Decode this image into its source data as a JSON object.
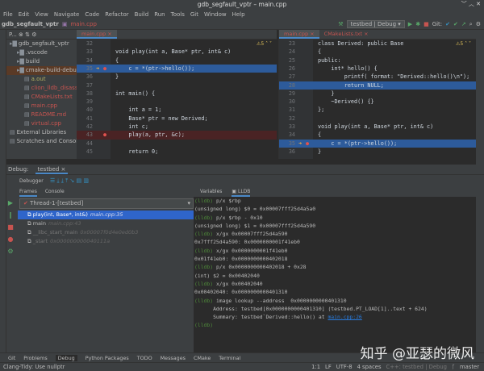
{
  "window": {
    "title": "gdb_segfault_vptr – main.cpp"
  },
  "menu": [
    "File",
    "Edit",
    "View",
    "Navigate",
    "Code",
    "Refactor",
    "Build",
    "Run",
    "Tools",
    "Git",
    "Window",
    "Help"
  ],
  "nav": {
    "project": "gdb_segfault_vptr",
    "file": "main.cpp",
    "run_config": "testbed | Debug",
    "git_label": "Git:"
  },
  "project": {
    "selector": "P...",
    "items": [
      {
        "label": "gdb_segfault_vptr",
        "indent": 0,
        "color": "#bbbbbb",
        "icon": "folder-icon"
      },
      {
        "label": ".vscode",
        "indent": 1,
        "color": "#bbbbbb",
        "icon": "folder-icon"
      },
      {
        "label": "build",
        "indent": 1,
        "color": "#bbbbbb",
        "icon": "folder-icon"
      },
      {
        "label": "cmake-build-debug",
        "indent": 1,
        "color": "#bbbbbb",
        "icon": "folder-icon",
        "selected": true
      },
      {
        "label": "a.out",
        "indent": 2,
        "color": "#b3ae60",
        "icon": "file-icon"
      },
      {
        "label": "clion_lldb_disassem",
        "indent": 2,
        "color": "#c75450",
        "icon": "file-icon"
      },
      {
        "label": "CMakeLists.txt",
        "indent": 2,
        "color": "#c75450",
        "icon": "cmake-icon"
      },
      {
        "label": "main.cpp",
        "indent": 2,
        "color": "#c75450",
        "icon": "cpp-file-icon"
      },
      {
        "label": "README.md",
        "indent": 2,
        "color": "#c75450",
        "icon": "file-icon"
      },
      {
        "label": "virtual.cpp",
        "indent": 2,
        "color": "#c75450",
        "icon": "cpp-file-icon"
      },
      {
        "label": "External Libraries",
        "indent": 0,
        "color": "#bbbbbb",
        "icon": "library-icon"
      },
      {
        "label": "Scratches and Consoles",
        "indent": 0,
        "color": "#bbbbbb",
        "icon": "scratch-icon"
      }
    ]
  },
  "left_editor": {
    "tabs": [
      "main.cpp"
    ],
    "warnings": "5",
    "lines": [
      {
        "n": "32",
        "t": ""
      },
      {
        "n": "33",
        "t": "void play(int a, Base* ptr, int& c)"
      },
      {
        "n": "34",
        "t": "{"
      },
      {
        "n": "35",
        "t": "    c = *(ptr->hello());",
        "hl": true,
        "exec": true
      },
      {
        "n": "36",
        "t": "}"
      },
      {
        "n": "37",
        "t": ""
      },
      {
        "n": "38",
        "t": "int main() {"
      },
      {
        "n": "39",
        "t": ""
      },
      {
        "n": "40",
        "t": "    int a = 1;"
      },
      {
        "n": "41",
        "t": "    Base* ptr = new Derived;"
      },
      {
        "n": "42",
        "t": "    int c;"
      },
      {
        "n": "43",
        "t": "    play(a, ptr, &c);",
        "bp": true
      },
      {
        "n": "44",
        "t": ""
      },
      {
        "n": "45",
        "t": "    return 0;"
      }
    ]
  },
  "right_editor": {
    "tabs": [
      "main.cpp",
      "CMakeLists.txt"
    ],
    "warnings": "5",
    "lines": [
      {
        "n": "23",
        "t": "class Derived: public Base"
      },
      {
        "n": "24",
        "t": "{"
      },
      {
        "n": "25",
        "t": "public:"
      },
      {
        "n": "26",
        "t": "    int* hello() {"
      },
      {
        "n": "27",
        "t": "        printf( format: \"Derived::hello()\\n\");"
      },
      {
        "n": "28",
        "t": "        return NULL;",
        "hl": true
      },
      {
        "n": "29",
        "t": "    }"
      },
      {
        "n": "30",
        "t": "    ~Derived() {}"
      },
      {
        "n": "31",
        "t": "};"
      },
      {
        "n": "32",
        "t": ""
      },
      {
        "n": "33",
        "t": "void play(int a, Base* ptr, int& c)"
      },
      {
        "n": "34",
        "t": "{"
      },
      {
        "n": "35",
        "t": "    c = *(ptr->hello());",
        "hl": true,
        "exec": true
      },
      {
        "n": "36",
        "t": "}"
      }
    ]
  },
  "debug": {
    "label": "Debug:",
    "session": "testbed",
    "debugger_tab": "Debugger",
    "frames_tab": "Frames",
    "console_tab": "Console",
    "thread": "Thread-1-[testbed]",
    "frames": [
      {
        "fn": "play(int, Base*, int&)",
        "loc": "main.cpp:35",
        "selected": true
      },
      {
        "fn": "main",
        "loc": "main.cpp:43"
      },
      {
        "fn": "__libc_start_main",
        "loc": "0x00007f0d4e0ed0b3"
      },
      {
        "fn": "_start",
        "loc": "0x000000000040111a"
      }
    ],
    "variables_tab": "Variables",
    "lldb_tab": "LLDB",
    "console": [
      {
        "p": "(lldb)",
        "t": " p/x $rbp"
      },
      {
        "t": "(unsigned long) $0 = 0x00007fff25d4a5a0"
      },
      {
        "p": "(lldb)",
        "t": " p/x $rbp - 0x10"
      },
      {
        "t": "(unsigned long) $1 = 0x00007fff25d4a590"
      },
      {
        "p": "(lldb)",
        "t": " x/gx 0x00007fff25d4a590"
      },
      {
        "t": "0x7fff25d4a590: 0x0000000001f41eb0"
      },
      {
        "p": "(lldb)",
        "t": " x/gx 0x0000000001f41eb0"
      },
      {
        "t": "0x01f41eb0: 0x0000000000402018"
      },
      {
        "p": "(lldb)",
        "t": " p/x 0x0000000000402018 + 0x28"
      },
      {
        "t": "(int) $2 = 0x00402040"
      },
      {
        "p": "(lldb)",
        "t": " x/gx 0x00402040"
      },
      {
        "t": "0x00402040: 0x0000000000401310"
      },
      {
        "p": "(lldb)",
        "t": " image lookup --address  0x0000000000401310"
      },
      {
        "t": "      Address: testbed[0x0000000000401310] (testbed.PT_LOAD[1]..text + 624)"
      },
      {
        "t": "      Summary: testbed`Derived::hello() at ",
        "link": "main.cpp:26"
      },
      {
        "p": "(lldb)",
        "t": " "
      }
    ]
  },
  "bottom_tabs": [
    "Git",
    "Problems",
    "Debug",
    "Python Packages",
    "TODO",
    "Messages",
    "CMake",
    "Terminal"
  ],
  "status": {
    "message": "Clang-Tidy: Use nullptr",
    "position": "1:1",
    "eol": "LF",
    "encoding": "UTF-8",
    "indent": "4 spaces",
    "context": "C++: testbed | Debug",
    "branch": "master"
  },
  "watermark": "知乎 @亚瑟的微风",
  "colors": {
    "accent": "#2f65ca",
    "background": "#2b2b2b",
    "panel": "#3c3f41"
  }
}
